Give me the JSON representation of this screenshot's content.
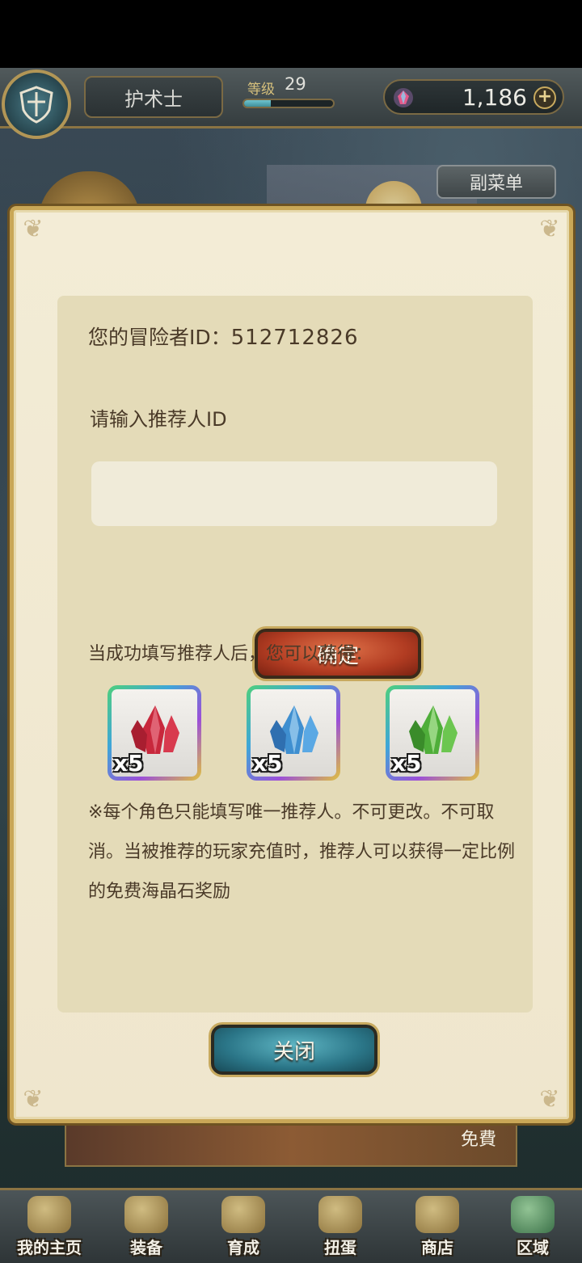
{
  "header": {
    "player_class": "护术士",
    "level_label": "等级",
    "level_value": "29",
    "xp_progress": 0.3,
    "gem_count": "1,186",
    "plus_label": "+",
    "submenu_label": "副菜单"
  },
  "dialog": {
    "adventurer_id_label": "您的冒险者ID：",
    "adventurer_id_value": "512712826",
    "prompt": "请输入推荐人ID",
    "input_value": "",
    "input_placeholder": "",
    "confirm_label": "确定",
    "reward_text": "当成功填写推荐人后，您可以获得：",
    "rewards": [
      {
        "icon": "red-crystal-icon",
        "color": "#c8283c",
        "qty": "x5"
      },
      {
        "icon": "blue-crystal-icon",
        "color": "#3f8fd0",
        "qty": "x5"
      },
      {
        "icon": "green-crystal-icon",
        "color": "#4fae3a",
        "qty": "x5"
      }
    ],
    "note": "※每个角色只能填写唯一推荐人。不可更改。不可取消。当被推荐的玩家充值时，推荐人可以获得一定比例的免费海晶石奖励",
    "close_label": "关闭"
  },
  "banner": {
    "free_label": "免費"
  },
  "nav": {
    "items": [
      {
        "label": "我的主页",
        "icon": "scroll-icon"
      },
      {
        "label": "装备",
        "icon": "helmet-icon"
      },
      {
        "label": "育成",
        "icon": "sword-icon"
      },
      {
        "label": "扭蛋",
        "icon": "bell-icon"
      },
      {
        "label": "商店",
        "icon": "bag-icon"
      },
      {
        "label": "区域",
        "icon": "globe-icon"
      }
    ]
  }
}
